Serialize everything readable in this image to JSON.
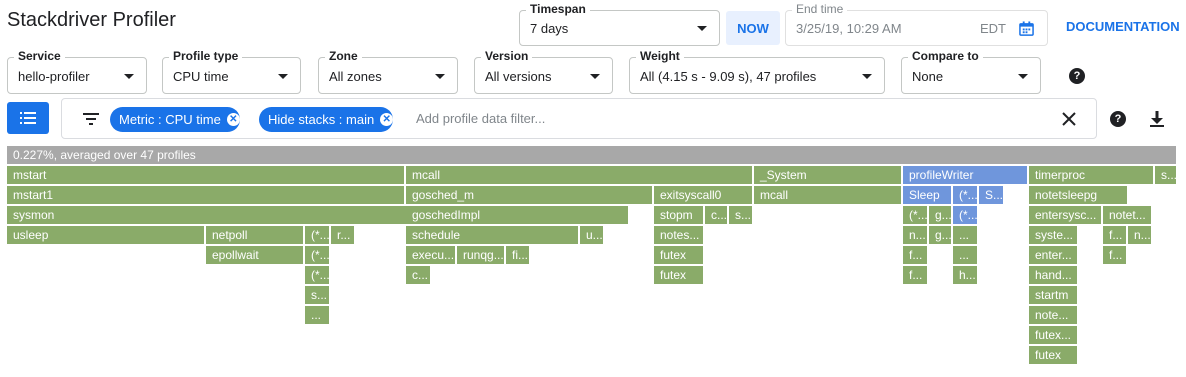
{
  "app": {
    "title": "Stackdriver Profiler"
  },
  "timespan": {
    "label": "Timespan",
    "value": "7 days"
  },
  "now_label": "NOW",
  "end_time": {
    "label": "End time",
    "value": "3/25/19, 10:29 AM",
    "tz": "EDT"
  },
  "documentation_label": "DOCUMENTATION",
  "filters": {
    "service": {
      "label": "Service",
      "value": "hello-profiler"
    },
    "profile_type": {
      "label": "Profile type",
      "value": "CPU time"
    },
    "zone": {
      "label": "Zone",
      "value": "All zones"
    },
    "version": {
      "label": "Version",
      "value": "All versions"
    },
    "weight": {
      "label": "Weight",
      "value": "All (4.15 s - 9.09 s), 47 profiles"
    },
    "compare_to": {
      "label": "Compare to",
      "value": "None"
    }
  },
  "filter_bar": {
    "chips": [
      {
        "key": "Metric",
        "value": "CPU time"
      },
      {
        "key": "Hide stacks",
        "value": "main"
      }
    ],
    "chip_labels": [
      "Metric : CPU time",
      "Hide stacks : main"
    ],
    "placeholder": "Add profile data filter..."
  },
  "icons": {
    "list": "list-icon",
    "filter": "filter-icon",
    "clear": "close-icon",
    "help": "help-icon",
    "download": "download-icon",
    "calendar": "calendar-icon",
    "caret": "caret-down-icon"
  },
  "colors": {
    "accent": "#1a73e8",
    "frame_green": "#8aab69",
    "frame_blue": "#6f96dc",
    "frame_root": "#a8a8a8",
    "chip_bg": "#1a73e8"
  },
  "flame": {
    "root_label": "0.227%, averaged over 47 profiles",
    "frames": [
      {
        "label": "mstart"
      },
      {
        "label": "mcall"
      },
      {
        "label": "_System"
      },
      {
        "label": "profileWriter",
        "highlight": true
      },
      {
        "label": "timerproc"
      },
      {
        "label": "s..."
      },
      {
        "label": "mstart1"
      },
      {
        "label": "gosched_m"
      },
      {
        "label": "exitsyscall0"
      },
      {
        "label": "mcall"
      },
      {
        "label": "Sleep",
        "highlight": true
      },
      {
        "label": "(*...",
        "highlight": true
      },
      {
        "label": "S...",
        "highlight": true
      },
      {
        "label": "notetsleepg"
      },
      {
        "label": "sysmon"
      },
      {
        "label": "goschedImpl"
      },
      {
        "label": "stopm"
      },
      {
        "label": "c..."
      },
      {
        "label": "s..."
      },
      {
        "label": "(*..."
      },
      {
        "label": "g..."
      },
      {
        "label": "(*...",
        "highlight": true
      },
      {
        "label": "entersysc..."
      },
      {
        "label": "notet..."
      },
      {
        "label": "usleep"
      },
      {
        "label": "netpoll"
      },
      {
        "label": "(*..."
      },
      {
        "label": "r..."
      },
      {
        "label": "schedule"
      },
      {
        "label": "u..."
      },
      {
        "label": "notes..."
      },
      {
        "label": "n..."
      },
      {
        "label": "g..."
      },
      {
        "label": "..."
      },
      {
        "label": "syste..."
      },
      {
        "label": "f..."
      },
      {
        "label": "n..."
      },
      {
        "label": "epollwait"
      },
      {
        "label": "(*..."
      },
      {
        "label": "execu..."
      },
      {
        "label": "runqg..."
      },
      {
        "label": "fi..."
      },
      {
        "label": "futex"
      },
      {
        "label": "f..."
      },
      {
        "label": "..."
      },
      {
        "label": "enter..."
      },
      {
        "label": "f..."
      },
      {
        "label": "(*..."
      },
      {
        "label": "c..."
      },
      {
        "label": "futex"
      },
      {
        "label": "f..."
      },
      {
        "label": "h..."
      },
      {
        "label": "hand..."
      },
      {
        "label": "s..."
      },
      {
        "label": "startm"
      },
      {
        "label": "..."
      },
      {
        "label": "note..."
      },
      {
        "label": "futex..."
      },
      {
        "label": "futex"
      }
    ]
  }
}
